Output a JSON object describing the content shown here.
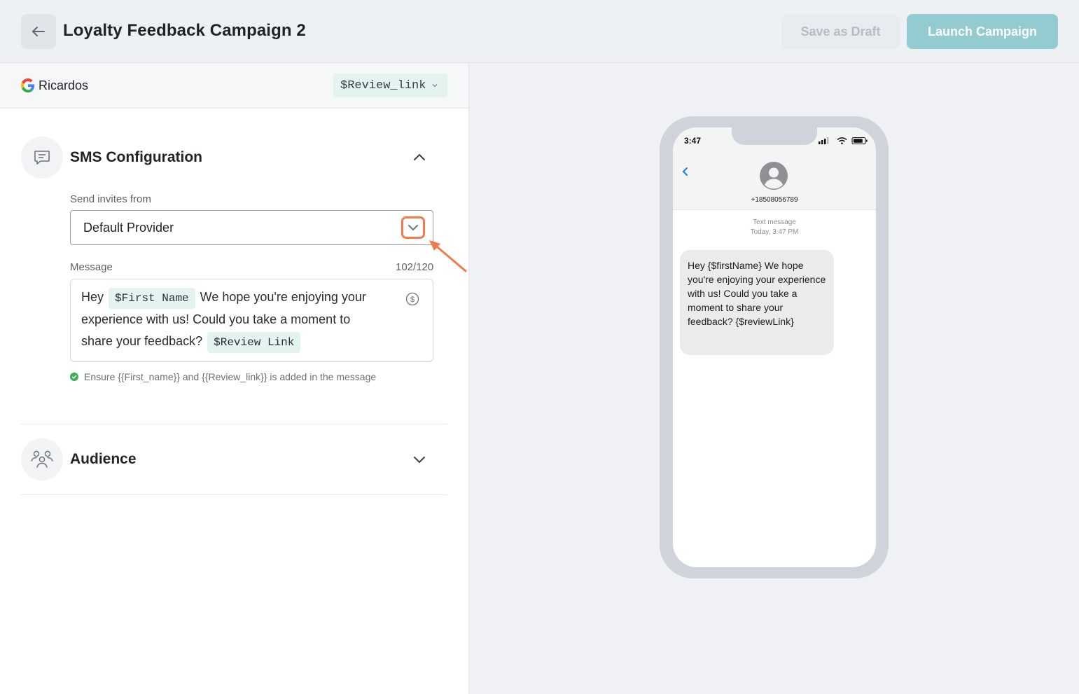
{
  "header": {
    "title": "Loyalty Feedback Campaign 2",
    "save_draft_label": "Save as Draft",
    "launch_label": "Launch Campaign"
  },
  "business": {
    "name": "Ricardos",
    "review_chip": "$Review_link"
  },
  "sms": {
    "title": "SMS Configuration",
    "send_from_label": "Send invites from",
    "provider_value": "Default Provider",
    "message_label": "Message",
    "char_count": "102/120",
    "message": {
      "part1": "Hey",
      "tag_first_name": "$First Name",
      "part2": "We hope you're enjoying your experience with us! Could you take a moment to share your feedback?",
      "tag_review_link": "$Review Link"
    },
    "hint": "Ensure {{First_name}} and {{Review_link}} is added in the message"
  },
  "audience": {
    "title": "Audience"
  },
  "phone_preview": {
    "time": "3:47",
    "number": "+18508056789",
    "meta_type": "Text message",
    "meta_time": "Today, 3:47 PM",
    "bubble_text": "Hey {$firstName} We hope you're enjoying your experience with us! Could you take a moment to share your feedback? {$reviewLink}"
  },
  "colors": {
    "accent_orange": "#f47a4c",
    "launch_button": "#93cbd1",
    "tag_background": "#e3f3f0",
    "success_green": "#3cae5a"
  },
  "icons": [
    "back-arrow-icon",
    "google-icon",
    "chevron-down-icon",
    "chat-icon",
    "chevron-up-icon",
    "dollar-icon",
    "check-circle-icon",
    "people-icon",
    "avatar-icon"
  ]
}
